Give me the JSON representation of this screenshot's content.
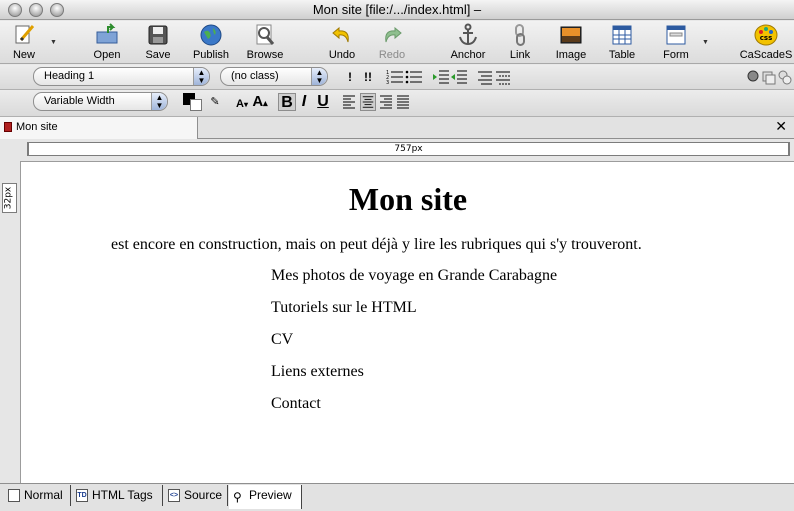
{
  "window": {
    "title": "Mon site [file:/.../index.html] –"
  },
  "toolbar": {
    "items": [
      {
        "label": "New",
        "icon": "new-icon"
      },
      {
        "label": "Open",
        "icon": "open-icon"
      },
      {
        "label": "Save",
        "icon": "save-icon"
      },
      {
        "label": "Publish",
        "icon": "publish-icon"
      },
      {
        "label": "Browse",
        "icon": "browse-icon"
      },
      {
        "label": "Undo",
        "icon": "undo-icon"
      },
      {
        "label": "Redo",
        "icon": "redo-icon"
      },
      {
        "label": "Anchor",
        "icon": "anchor-icon"
      },
      {
        "label": "Link",
        "icon": "link-icon"
      },
      {
        "label": "Image",
        "icon": "image-icon"
      },
      {
        "label": "Table",
        "icon": "table-icon"
      },
      {
        "label": "Form",
        "icon": "form-icon"
      },
      {
        "label": "CaScadeS",
        "icon": "cascades-icon"
      }
    ]
  },
  "format": {
    "paragraph_style": "Heading 1",
    "class": "(no class)",
    "font": "Variable Width",
    "text_color": "#000000"
  },
  "document_tab": {
    "label": "Mon site"
  },
  "rulers": {
    "width_label": "757px",
    "height_label": "32px"
  },
  "content": {
    "heading": "Mon site",
    "intro": "est encore en construction, mais on peut déjà y lire les rubriques qui s'y trouveront.",
    "links": [
      "Mes photos de voyage en Grande Carabagne",
      "Tutoriels sur le HTML",
      "CV",
      "Liens externes",
      "Contact"
    ]
  },
  "modes": [
    {
      "label": "Normal",
      "icon": "page-icon"
    },
    {
      "label": "HTML Tags",
      "icon": "td-icon"
    },
    {
      "label": "Source",
      "icon": "source-icon"
    },
    {
      "label": "Preview",
      "icon": "magnifier-icon"
    }
  ],
  "colors": {
    "link_blue": "#1a3d8f",
    "accent_yellow": "#f2c200",
    "doc_icon_red": "#b02020"
  }
}
